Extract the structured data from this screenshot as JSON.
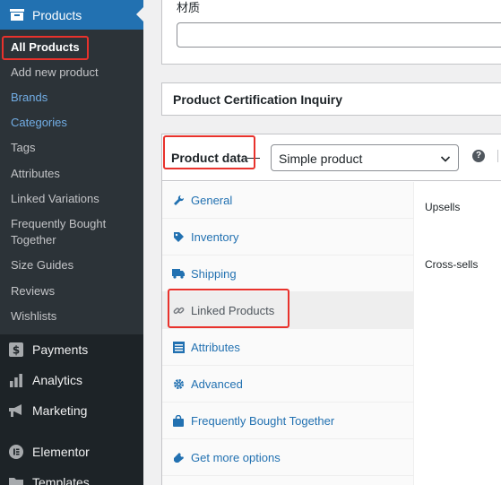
{
  "sidebar": {
    "products_label": "Products",
    "submenu": [
      {
        "label": "All Products",
        "current": true
      },
      {
        "label": "Add new product"
      },
      {
        "label": "Brands",
        "highlight": true
      },
      {
        "label": "Categories",
        "highlight": true
      },
      {
        "label": "Tags"
      },
      {
        "label": "Attributes"
      },
      {
        "label": "Linked Variations"
      },
      {
        "label": "Frequently Bought Together"
      },
      {
        "label": "Size Guides"
      },
      {
        "label": "Reviews"
      },
      {
        "label": "Wishlists"
      }
    ],
    "menu": [
      {
        "label": "Payments",
        "icon": "dollar-icon"
      },
      {
        "label": "Analytics",
        "icon": "bar-chart-icon"
      },
      {
        "label": "Marketing",
        "icon": "megaphone-icon"
      },
      {
        "label": "Elementor",
        "icon": "elementor-icon"
      },
      {
        "label": "Templates",
        "icon": "folder-icon"
      }
    ]
  },
  "content": {
    "material_label": "材质",
    "material_value": "",
    "certification_title": "Product Certification Inquiry",
    "product_data_title": "Product data",
    "product_type_value": "Simple product",
    "help_label": "?",
    "tabs": [
      {
        "label": "General",
        "icon": "wrench-icon"
      },
      {
        "label": "Inventory",
        "icon": "tag-icon"
      },
      {
        "label": "Shipping",
        "icon": "truck-icon"
      },
      {
        "label": "Linked Products",
        "icon": "link-icon",
        "active": true
      },
      {
        "label": "Attributes",
        "icon": "list-icon"
      },
      {
        "label": "Advanced",
        "icon": "gear-icon"
      },
      {
        "label": "Frequently Bought Together",
        "icon": "bag-icon"
      },
      {
        "label": "Get more options",
        "icon": "plugin-icon"
      }
    ],
    "fields": {
      "upsells_label": "Upsells",
      "crosssells_label": "Cross-sells"
    }
  },
  "colors": {
    "sidebar_bg": "#1d2327",
    "submenu_bg": "#2c3338",
    "accent": "#2271b1",
    "link_blue": "#72aee6",
    "annotation_red": "#e8322c"
  }
}
